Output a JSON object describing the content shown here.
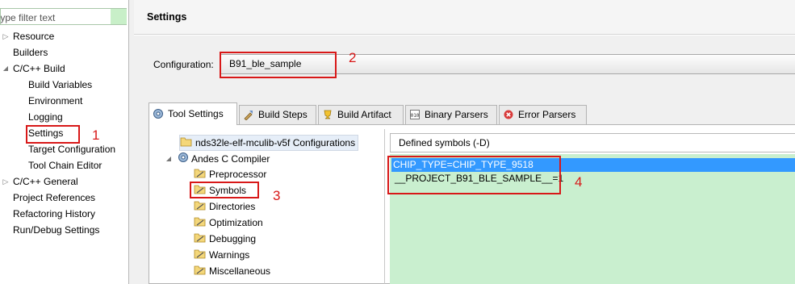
{
  "sidebar": {
    "filter_placeholder": "type filter text",
    "items": [
      {
        "label": "Resource",
        "expander": "▷"
      },
      {
        "label": "Builders"
      },
      {
        "label": "C/C++ Build",
        "expander": "◢"
      },
      {
        "label": "Build Variables"
      },
      {
        "label": "Environment"
      },
      {
        "label": "Logging"
      },
      {
        "label": "Settings"
      },
      {
        "label": "Target Configuration"
      },
      {
        "label": "Tool Chain Editor"
      },
      {
        "label": "C/C++ General",
        "expander": "▷"
      },
      {
        "label": "Project References"
      },
      {
        "label": "Refactoring History"
      },
      {
        "label": "Run/Debug Settings"
      }
    ]
  },
  "page": {
    "title": "Settings",
    "config_label": "Configuration:",
    "config_value": "B91_ble_sample"
  },
  "tabs": [
    {
      "label": "Tool Settings",
      "icon": "tool-settings-icon",
      "active": true
    },
    {
      "label": "Build Steps",
      "icon": "build-steps-icon"
    },
    {
      "label": "Build Artifact",
      "icon": "build-artifact-icon"
    },
    {
      "label": "Binary Parsers",
      "icon": "binary-parsers-icon"
    },
    {
      "label": "Error Parsers",
      "icon": "error-parsers-icon"
    }
  ],
  "tree": {
    "root": "nds32le-elf-mculib-v5f Configurations",
    "compiler": "Andes C Compiler",
    "compiler_expander": "◢",
    "children": [
      "Preprocessor",
      "Symbols",
      "Directories",
      "Optimization",
      "Debugging",
      "Warnings",
      "Miscellaneous"
    ]
  },
  "symbols": {
    "header": "Defined symbols (-D)",
    "items": [
      "CHIP_TYPE=CHIP_TYPE_9518",
      "__PROJECT_B91_BLE_SAMPLE__=1"
    ]
  },
  "annotations": [
    "1",
    "2",
    "3",
    "4"
  ],
  "colors": {
    "annotation": "#d81818",
    "selection": "#3399ff",
    "symbols_bg": "#c9efcf"
  }
}
